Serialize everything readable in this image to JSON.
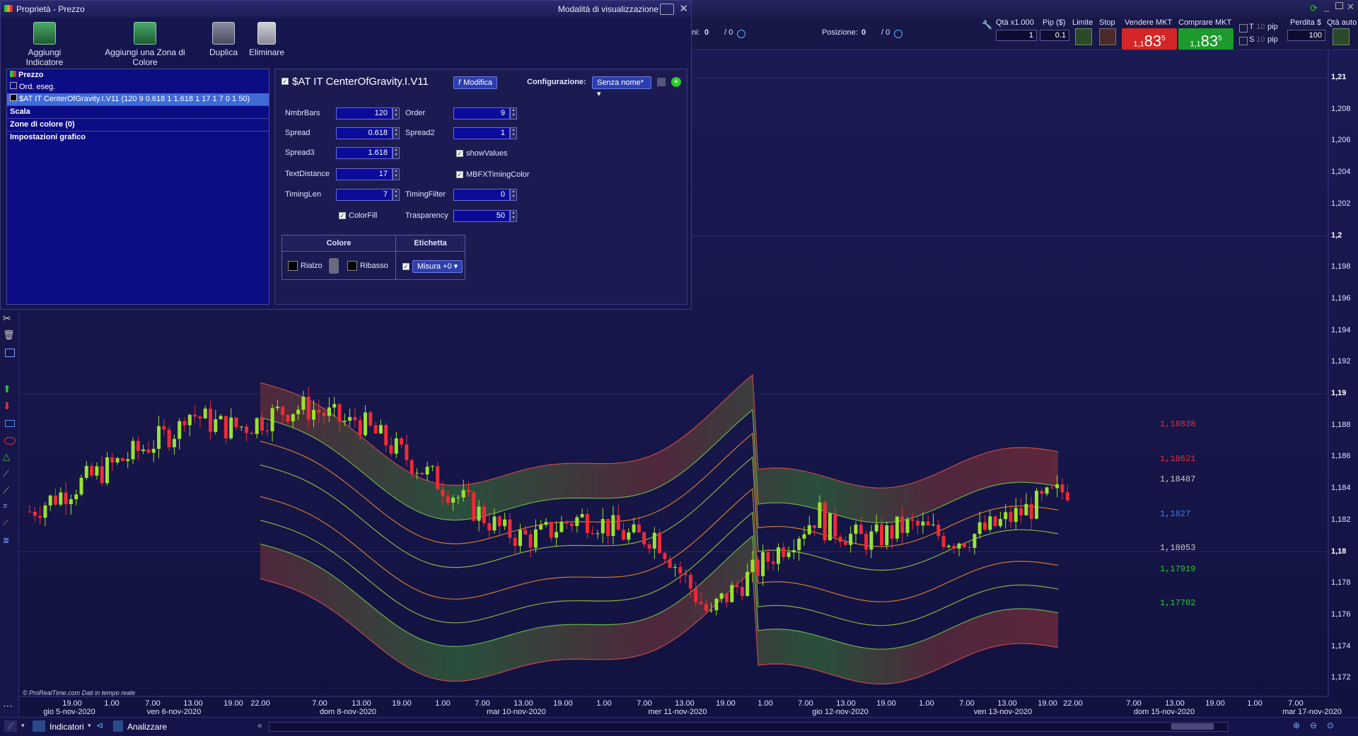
{
  "properties_window": {
    "title": "Proprietà - Prezzo",
    "mode_label": "Modalità di visualizzazione",
    "toolbar": {
      "add_indicator": "Aggiungi Indicatore",
      "add_color_zone": "Aggiungi una Zona di Colore",
      "duplicate": "Duplica",
      "delete": "Eliminare"
    },
    "tree": {
      "price": "Prezzo",
      "orders": "Ord. eseg.",
      "indicator": "$AT IT CenterOfGravity.I.V11 (120 9 0.618 1 1.618 1 17 1 7 0 1 50)",
      "scale": "Scala",
      "color_zones": "Zone di colore (0)",
      "chart_settings": "Impostazioni grafico"
    },
    "panel": {
      "indicator_name": "$AT IT CenterOfGravity.I.V11",
      "modify": "Modifica",
      "config_label": "Configurazione:",
      "config_value": "Senza nome*",
      "params": {
        "nmbrbars_label": "NmbrBars",
        "nmbrbars": "120",
        "order_label": "Order",
        "order": "9",
        "spread_label": "Spread",
        "spread": "0.618",
        "spread2_label": "Spread2",
        "spread2": "1",
        "spread3_label": "Spread3",
        "spread3": "1.618",
        "showvalues_label": "showValues",
        "textdistance_label": "TextDistance",
        "textdistance": "17",
        "mbfx_label": "MBFXTimingColor",
        "timinglen_label": "TimingLen",
        "timinglen": "7",
        "timingfilter_label": "TimingFilter",
        "timingfilter": "0",
        "colorfill_label": "ColorFill",
        "transparency_label": "Trasparency",
        "transparency": "50"
      },
      "color_table": {
        "col_color": "Colore",
        "col_label": "Etichetta",
        "rise": "Rialzo",
        "fall": "Ribasso",
        "measure": "Misura +0"
      }
    }
  },
  "trading_bar": {
    "qty_label": "Qtà x1.000",
    "qty_value": "1",
    "pip_label": "Pip ($)",
    "pip_value": "0.1",
    "limit_label": "Limite",
    "stop_label": "Stop",
    "sell_label": "Vendere MKT",
    "buy_label": "Comprare MKT",
    "sell_prefix": "1,1",
    "sell_big": "83",
    "sell_sup": "5",
    "buy_prefix": "1,1",
    "buy_big": "83",
    "buy_sup": "5",
    "t_label": "T",
    "t_value": "10",
    "s_label": "S",
    "s_value": "10",
    "pip_unit": "pip",
    "loss_label": "Perdita $",
    "loss_value": "100",
    "auto_qty_label": "Qtà auto",
    "ni_label": "ni:",
    "ni_value": "0",
    "ni_value2": "/ 0",
    "position_label": "Posizione:",
    "position_value": "0",
    "position_value2": "/ 0"
  },
  "chart": {
    "source_note": "© ProRealTime.com  Dati in tempo reale",
    "y_axis": [
      "1,21",
      "1,208",
      "1,206",
      "1,204",
      "1,202",
      "1,2",
      "1,198",
      "1,196",
      "1,194",
      "1,192",
      "1,19",
      "1,188",
      "1,186",
      "1,184",
      "1,182",
      "1,18",
      "1,178",
      "1,176",
      "1,174",
      "1,172"
    ],
    "level_labels": [
      {
        "text": "1,18838",
        "color": "#e0303a"
      },
      {
        "text": "1,18621",
        "color": "#e0303a"
      },
      {
        "text": "1,18487",
        "color": "#c8c8c8"
      },
      {
        "text": "1,1827",
        "color": "#3a7cff"
      },
      {
        "text": "1,18053",
        "color": "#c8c8c8"
      },
      {
        "text": "1,17919",
        "color": "#2ec82e"
      },
      {
        "text": "1,17702",
        "color": "#2ec82e"
      }
    ],
    "x_times": [
      "19.00",
      "1.00",
      "7.00",
      "13.00",
      "19.00",
      "22.00",
      "7.00",
      "13.00",
      "19.00",
      "1.00",
      "7.00",
      "13.00",
      "19.00",
      "1.00",
      "7.00",
      "13.00",
      "19.00",
      "1.00",
      "7.00",
      "13.00",
      "19.00",
      "1.00",
      "7.00",
      "13.00",
      "19.00",
      "22.00",
      "7.00",
      "13.00",
      "19.00",
      "1.00",
      "7.00"
    ],
    "x_dates": [
      "gio 5-nov-2020",
      "ven 6-nov-2020",
      "dom 8-nov-2020",
      "mar 10-nov-2020",
      "mer 11-nov-2020",
      "gio 12-nov-2020",
      "ven 13-nov-2020",
      "dom 15-nov-2020",
      "mar 17-nov-2020"
    ]
  },
  "bottom_bar": {
    "indicators": "Indicatori",
    "analyzer": "Analizzare"
  }
}
